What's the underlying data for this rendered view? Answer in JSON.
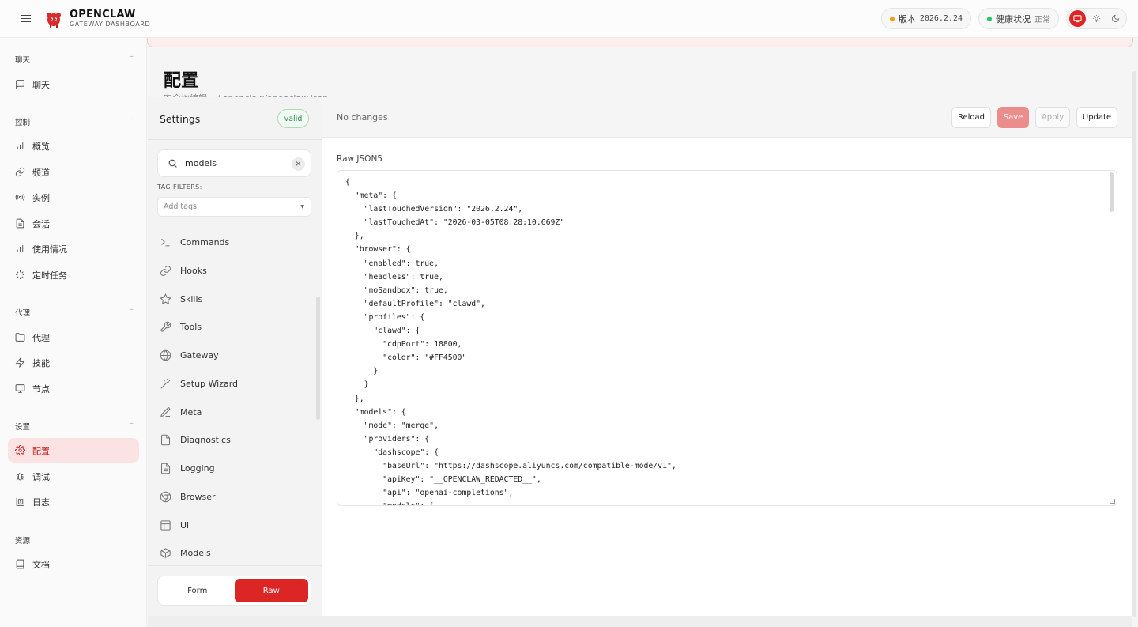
{
  "app": {
    "name": "OPENCLAW",
    "subtitle": "GATEWAY DASHBOARD"
  },
  "topbar": {
    "version_label": "版本",
    "version_value": "2026.2.24",
    "health_label": "健康状况",
    "health_value": "正常",
    "version_dot_color": "#f59e0b",
    "health_dot_color": "#22c55e",
    "theme_icons": [
      "monitor-icon",
      "sun-icon",
      "moon-icon"
    ]
  },
  "sidebar": {
    "groups": [
      {
        "title": "聊天",
        "items": [
          {
            "label": "聊天",
            "icon": "chat-icon"
          }
        ]
      },
      {
        "title": "控制",
        "items": [
          {
            "label": "概览",
            "icon": "bar-chart-icon"
          },
          {
            "label": "频道",
            "icon": "link-icon"
          },
          {
            "label": "实例",
            "icon": "broadcast-icon"
          },
          {
            "label": "会话",
            "icon": "document-icon"
          },
          {
            "label": "使用情况",
            "icon": "bar-chart-icon"
          },
          {
            "label": "定时任务",
            "icon": "loader-icon"
          }
        ]
      },
      {
        "title": "代理",
        "items": [
          {
            "label": "代理",
            "icon": "folder-icon"
          },
          {
            "label": "技能",
            "icon": "lightning-icon"
          },
          {
            "label": "节点",
            "icon": "monitor-icon"
          }
        ]
      },
      {
        "title": "设置",
        "items": [
          {
            "label": "配置",
            "icon": "gear-icon",
            "active": true
          },
          {
            "label": "调试",
            "icon": "bug-icon"
          },
          {
            "label": "日志",
            "icon": "log-icon"
          }
        ]
      },
      {
        "title": "资源",
        "items": [
          {
            "label": "文档",
            "icon": "book-icon"
          }
        ]
      }
    ]
  },
  "page": {
    "title": "配置",
    "subtitle": "安全地编辑 ~/.openclaw/openclaw.json"
  },
  "settings": {
    "title": "Settings",
    "status": "valid",
    "search_value": "models",
    "tag_filters_label": "TAG FILTERS:",
    "tag_placeholder": "Add tags",
    "sections": [
      {
        "label": "Commands",
        "icon": "terminal-icon"
      },
      {
        "label": "Hooks",
        "icon": "link-icon"
      },
      {
        "label": "Skills",
        "icon": "star-icon"
      },
      {
        "label": "Tools",
        "icon": "wrench-icon"
      },
      {
        "label": "Gateway",
        "icon": "globe-icon"
      },
      {
        "label": "Setup Wizard",
        "icon": "wand-icon"
      },
      {
        "label": "Meta",
        "icon": "pencil-icon"
      },
      {
        "label": "Diagnostics",
        "icon": "file-icon"
      },
      {
        "label": "Logging",
        "icon": "file-text-icon"
      },
      {
        "label": "Browser",
        "icon": "chrome-icon"
      },
      {
        "label": "Ui",
        "icon": "layout-icon"
      },
      {
        "label": "Models",
        "icon": "cube-icon"
      }
    ],
    "mode_form": "Form",
    "mode_raw": "Raw"
  },
  "editor": {
    "status": "No changes",
    "buttons": {
      "reload": "Reload",
      "save": "Save",
      "apply": "Apply",
      "update": "Update"
    },
    "label": "Raw JSON5",
    "code": "{\n  \"meta\": {\n    \"lastTouchedVersion\": \"2026.2.24\",\n    \"lastTouchedAt\": \"2026-03-05T08:28:10.669Z\"\n  },\n  \"browser\": {\n    \"enabled\": true,\n    \"headless\": true,\n    \"noSandbox\": true,\n    \"defaultProfile\": \"clawd\",\n    \"profiles\": {\n      \"clawd\": {\n        \"cdpPort\": 18800,\n        \"color\": \"#FF4500\"\n      }\n    }\n  },\n  \"models\": {\n    \"mode\": \"merge\",\n    \"providers\": {\n      \"dashscope\": {\n        \"baseUrl\": \"https://dashscope.aliyuncs.com/compatible-mode/v1\",\n        \"apiKey\": \"__OPENCLAW_REDACTED__\",\n        \"api\": \"openai-completions\",\n        \"models\": ["
  },
  "colors": {
    "accent": "#dc2626",
    "accent_soft": "#fbe3e3",
    "valid_green": "#2f8f4a"
  }
}
